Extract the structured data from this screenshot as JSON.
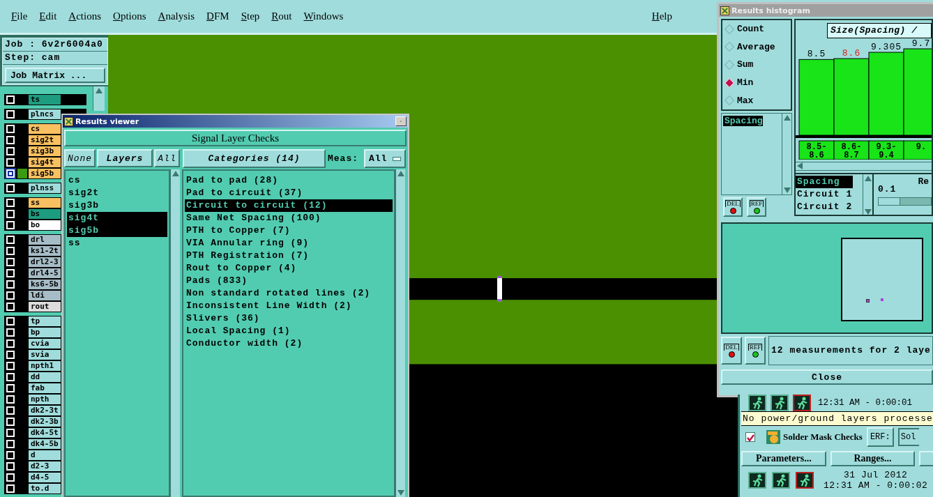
{
  "menu_bar": {
    "items": [
      "File",
      "Edit",
      "Actions",
      "Options",
      "Analysis",
      "DFM",
      "Step",
      "Rout",
      "Windows"
    ],
    "help": "Help"
  },
  "job_panel": {
    "job": "Job : 6v2r6004a0",
    "step": "Step: cam",
    "matrix_button": "Job Matrix ..."
  },
  "layer_groups": [
    {
      "layers": [
        {
          "name": "ts",
          "color": "#1e9c80",
          "active": false
        }
      ]
    },
    {
      "layers": [
        {
          "name": "plncs",
          "color": "#a0dcdc",
          "active": false
        }
      ]
    },
    {
      "layers": [
        {
          "name": "cs",
          "color": "#f8c060",
          "active": false
        },
        {
          "name": "sig2t",
          "color": "#f8c060",
          "active": false
        },
        {
          "name": "sig3b",
          "color": "#f8c060",
          "active": false
        },
        {
          "name": "sig4t",
          "color": "#f8c060",
          "active": false
        },
        {
          "name": "sig5b",
          "color": "#f8c060",
          "active": true
        }
      ]
    },
    {
      "layers": [
        {
          "name": "plnss",
          "color": "#a0dcdc",
          "active": false
        }
      ]
    },
    {
      "layers": [
        {
          "name": "ss",
          "color": "#f8c060",
          "active": false
        },
        {
          "name": "bs",
          "color": "#1e9c80",
          "active": false
        },
        {
          "name": "bo",
          "color": "#ffffff",
          "active": false
        }
      ]
    },
    {
      "layers": [
        {
          "name": "drl",
          "color": "#a6bcc6",
          "active": false
        },
        {
          "name": "ks1-2t",
          "color": "#a6bcc6",
          "active": false
        },
        {
          "name": "drl2-3",
          "color": "#a6bcc6",
          "active": false
        },
        {
          "name": "drl4-5",
          "color": "#a6bcc6",
          "active": false
        },
        {
          "name": "ks6-5b",
          "color": "#a6bcc6",
          "active": false
        },
        {
          "name": "ldi",
          "color": "#a6bcc6",
          "active": false
        },
        {
          "name": "rout",
          "color": "#dcdcdc",
          "active": false
        }
      ]
    },
    {
      "layers": [
        {
          "name": "tp",
          "color": "#a0dcdc",
          "active": false
        },
        {
          "name": "bp",
          "color": "#a0dcdc",
          "active": false
        },
        {
          "name": "cvia",
          "color": "#a0dcdc",
          "active": false
        },
        {
          "name": "svia",
          "color": "#a0dcdc",
          "active": false
        },
        {
          "name": "npth1",
          "color": "#a0dcdc",
          "active": false
        },
        {
          "name": "dd",
          "color": "#a0dcdc",
          "active": false
        },
        {
          "name": "fab",
          "color": "#a0dcdc",
          "active": false
        },
        {
          "name": "npth",
          "color": "#a0dcdc",
          "active": false
        },
        {
          "name": "dk2-3t",
          "color": "#a0dcdc",
          "active": false
        },
        {
          "name": "dk2-3b",
          "color": "#a0dcdc",
          "active": false
        },
        {
          "name": "dk4-5t",
          "color": "#a0dcdc",
          "active": false
        },
        {
          "name": "dk4-5b",
          "color": "#a0dcdc",
          "active": false
        },
        {
          "name": "d",
          "color": "#a0dcdc",
          "active": false
        },
        {
          "name": "d2-3",
          "color": "#a0dcdc",
          "active": false
        },
        {
          "name": "d4-5",
          "color": "#a0dcdc",
          "active": false
        },
        {
          "name": "to.d",
          "color": "#a0dcdc",
          "active": false
        }
      ]
    }
  ],
  "results_viewer": {
    "title": "Results viewer",
    "check_button": "Signal Layer Checks",
    "none_button": "None",
    "layers_label": "Layers",
    "all_button": "All",
    "categories_button": "Categories (14)",
    "meas_label": "Meas:",
    "meas_value": "All",
    "layers": [
      {
        "name": "cs",
        "selected": false
      },
      {
        "name": "sig2t",
        "selected": false
      },
      {
        "name": "sig3b",
        "selected": false
      },
      {
        "name": "sig4t",
        "selected": true
      },
      {
        "name": "sig5b",
        "selected": true
      },
      {
        "name": "ss",
        "selected": false
      }
    ],
    "categories": [
      {
        "name": "Pad to pad (28)",
        "selected": false
      },
      {
        "name": "Pad to circuit (37)",
        "selected": false
      },
      {
        "name": "Circuit to circuit (12)",
        "selected": true
      },
      {
        "name": "Same Net Spacing (100)",
        "selected": false
      },
      {
        "name": "PTH to Copper (7)",
        "selected": false
      },
      {
        "name": "VIA Annular ring (9)",
        "selected": false
      },
      {
        "name": "PTH Registration (7)",
        "selected": false
      },
      {
        "name": "Rout to Copper (4)",
        "selected": false
      },
      {
        "name": "Pads (833)",
        "selected": false
      },
      {
        "name": "Non standard rotated lines (2)",
        "selected": false
      },
      {
        "name": "Inconsistent Line Width (2)",
        "selected": false
      },
      {
        "name": "Slivers (36)",
        "selected": false
      },
      {
        "name": "Local Spacing (1)",
        "selected": false
      },
      {
        "name": "Conductor width (2)",
        "selected": false
      }
    ]
  },
  "histogram": {
    "title": "Results histogram",
    "modes": [
      {
        "label": "Count",
        "selected": false
      },
      {
        "label": "Average",
        "selected": false
      },
      {
        "label": "Sum",
        "selected": false
      },
      {
        "label": "Min",
        "selected": true
      },
      {
        "label": "Max",
        "selected": false
      }
    ],
    "measure_list": [
      {
        "label": "Spacing",
        "selected": true
      }
    ],
    "del_button": "DEL",
    "ref_button": "REF",
    "chart_title": "Size(Spacing) /",
    "chart_data": {
      "type": "bar",
      "categories": [
        "8.5-8.6",
        "8.6-8.7",
        "9.3-9.4",
        "9."
      ],
      "values": [
        8.5,
        8.6,
        9.305,
        9.7
      ],
      "value_labels": [
        "8.5",
        "8.6",
        "9.305",
        "9.7"
      ],
      "data_labels": true
    },
    "bins": [
      {
        "selected": false
      },
      {
        "selected": true
      },
      {
        "selected": false
      },
      {
        "selected": false
      }
    ],
    "series_list": [
      {
        "label": "Spacing",
        "selected": true
      },
      {
        "label": "Circuit 1",
        "selected": false
      },
      {
        "label": "Circuit 2",
        "selected": false
      }
    ],
    "range_label": "Re",
    "range_value": "0.1",
    "range_slider": {
      "level": 0
    },
    "status_del_button": "DEL",
    "status_ref_button": "REF",
    "status": "12 measurements for 2 laye",
    "close_button": "Close"
  },
  "checks_panel": {
    "first_time": "12:31 AM - 0:00:01",
    "message": "No power/ground layers processe",
    "check": {
      "checked": true,
      "label": "Solder Mask Checks"
    },
    "erf_button": "ERF:",
    "erf_value": "Sol",
    "parameters_button": "Parameters...",
    "ranges_button": "Ranges...",
    "date": "31 Jul 2012",
    "time": "12:31 AM - 0:00:02"
  }
}
